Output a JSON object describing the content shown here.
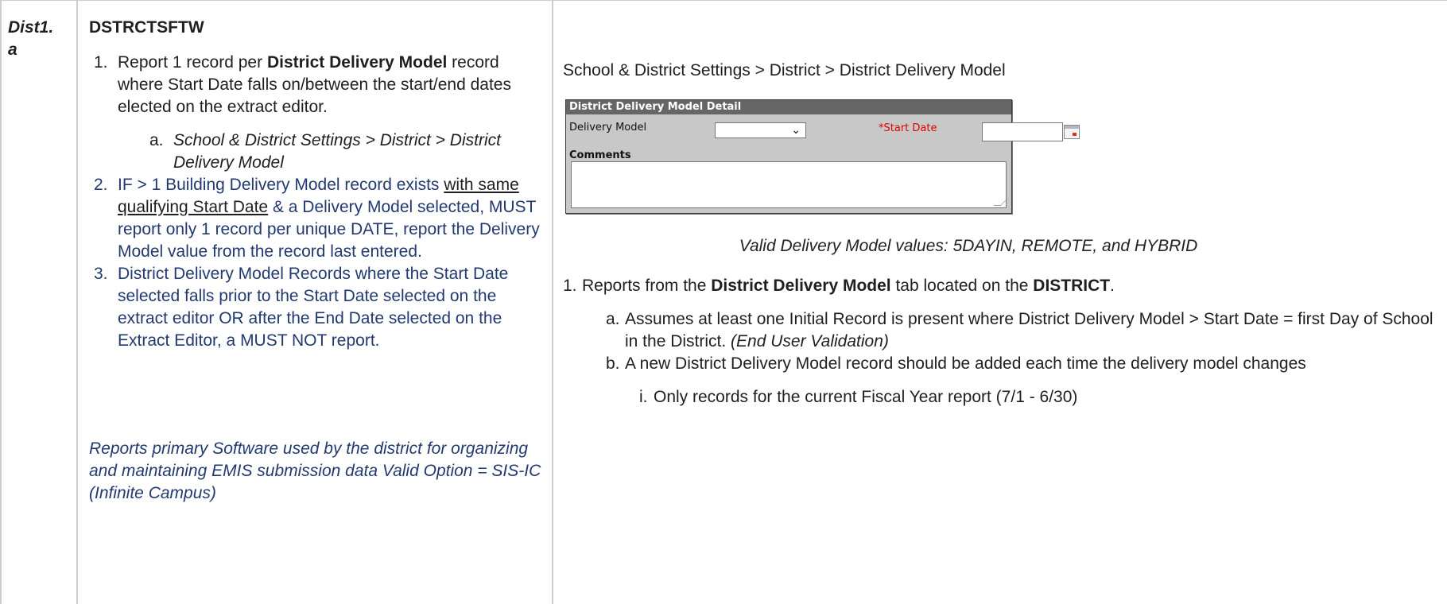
{
  "row_id": "Dist1.\na",
  "field_code": "DSTRCTSFTW",
  "left_list": {
    "item1_num": "1.",
    "item1_pre": "Report 1 record per ",
    "item1_bold": "District Delivery Model",
    "item1_post": " record where Start Date falls on/between the start/end dates elected on the extract editor.",
    "item1a_num": "a.",
    "item1a_text": "School & District Settings > District > District Delivery Model",
    "item2_num": "2.",
    "item2_pre": "IF > 1 Building Delivery Model record exists ",
    "item2_u1": "with same",
    "item2_mid": " ",
    "item2_u2": "qualifying Start Date",
    "item2_post": " & a Delivery Model selected, MUST report only 1 record per unique DATE, report the Delivery Model value from the record last entered.",
    "item3_num": "3.",
    "item3_text": "District Delivery Model Records where the Start Date selected falls prior to the Start Date selected on the extract editor OR after the End Date selected on the Extract Editor, a MUST NOT report."
  },
  "left_note": "Reports primary Software used by the district for organizing and maintaining EMIS submission data  Valid Option = SIS-IC (Infinite Campus)",
  "right": {
    "path": "School & District Settings > District > District Delivery Model",
    "panel": {
      "title": "District Delivery Model Detail",
      "delivery_model_label": "Delivery Model",
      "delivery_model_value": "",
      "start_date_label": "*Start Date",
      "start_date_value": "",
      "comments_label": "Comments",
      "comments_value": ""
    },
    "valid_values": "Valid Delivery Model values: 5DAYIN, REMOTE, and HYBRID",
    "list": {
      "n1": "1.",
      "i1_pre": "Reports from the ",
      "i1_b1": "District Delivery Model",
      "i1_mid": " tab located on the ",
      "i1_b2": "DISTRICT",
      "i1_post": ".",
      "na": "a.",
      "ia_text": "Assumes at least one Initial Record is present where District Delivery Model > Start Date = first Day of School in the District. ",
      "ia_italic": "(End User Validation)",
      "nb": "b.",
      "ib_text": "A new District Delivery Model record should be added each time the delivery model changes",
      "ni": "i.",
      "ii_text": "Only records for the current Fiscal Year report (7/1 - 6/30)"
    }
  }
}
